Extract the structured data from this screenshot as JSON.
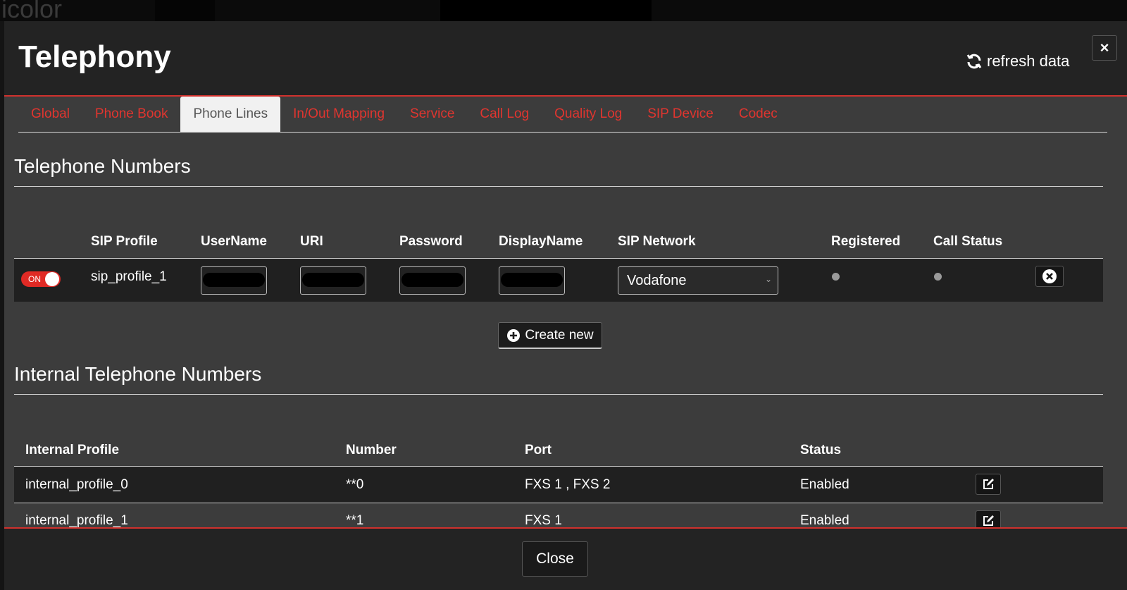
{
  "background": {
    "partial_text": "icolor"
  },
  "modal": {
    "title": "Telephony",
    "refresh_label": "refresh data",
    "close_icon": "×"
  },
  "tabs": [
    {
      "label": "Global"
    },
    {
      "label": "Phone Book"
    },
    {
      "label": "Phone Lines",
      "active": true
    },
    {
      "label": "In/Out Mapping"
    },
    {
      "label": "Service"
    },
    {
      "label": "Call Log"
    },
    {
      "label": "Quality Log"
    },
    {
      "label": "SIP Device"
    },
    {
      "label": "Codec"
    }
  ],
  "telephone_numbers": {
    "title": "Telephone Numbers",
    "columns": {
      "sip_profile": "SIP Profile",
      "username": "UserName",
      "uri": "URI",
      "password": "Password",
      "display_name": "DisplayName",
      "sip_network": "SIP Network",
      "registered": "Registered",
      "call_status": "Call Status"
    },
    "rows": [
      {
        "enabled_toggle": "ON",
        "sip_profile": "sip_profile_1",
        "sip_network": "Vodafone"
      }
    ],
    "create_new_label": "Create new"
  },
  "internal_numbers": {
    "title": "Internal Telephone Numbers",
    "columns": {
      "internal_profile": "Internal Profile",
      "number": "Number",
      "port": "Port",
      "status": "Status"
    },
    "rows": [
      {
        "internal_profile": "internal_profile_0",
        "number": "**0",
        "port": "FXS 1 , FXS 2",
        "status": "Enabled"
      },
      {
        "internal_profile": "internal_profile_1",
        "number": "**1",
        "port": "FXS 1",
        "status": "Enabled"
      }
    ]
  },
  "footer": {
    "close_label": "Close"
  },
  "colors": {
    "accent": "#e0352f",
    "modal_bg": "#3c3c3c",
    "header_bg": "#232323",
    "row_dark": "#202020",
    "tab_active_bg": "#f1f1f1"
  }
}
